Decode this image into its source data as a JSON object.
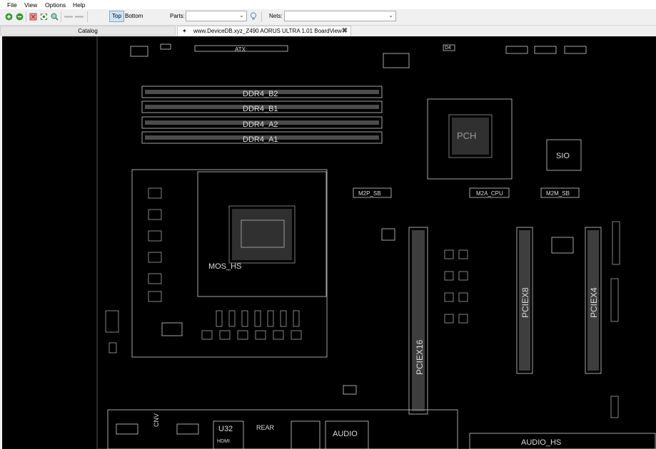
{
  "menu": {
    "items": [
      {
        "label": "File"
      },
      {
        "label": "View"
      },
      {
        "label": "Options"
      },
      {
        "label": "Help"
      }
    ]
  },
  "toolbar": {
    "icons": [
      "zoom-in-icon",
      "zoom-out-icon",
      "fit-icon",
      "fit-screen-icon",
      "zoom-area-icon",
      "back-icon",
      "forward-icon"
    ],
    "side_top": "Top",
    "side_bottom": "Bottom",
    "parts_label": "Parts:",
    "parts_value": "",
    "nets_label": "Nets:",
    "nets_value": ""
  },
  "tabs": {
    "catalog": "Catalog",
    "document_pin": "✶",
    "document": "www.DeviceDB.xyz_Z490 AORUS ULTRA 1.01 BoardView",
    "close": "✖"
  },
  "board": {
    "labels": {
      "atx": "ATX",
      "ddr4_b2": "DDR4_B2",
      "ddr4_b1": "DDR4_B1",
      "ddr4_a2": "DDR4_A2",
      "ddr4_a1": "DDR4_A1",
      "pch": "PCH",
      "sio": "SIO",
      "m2p_sb": "M2P_SB",
      "m2a_cpu": "M2A_CPU",
      "m2m_sb": "M2M_SB",
      "mos_hs": "MOS_HS",
      "pciex16": "PCIEX16",
      "pciex8": "PCIEX8",
      "pciex4": "PCIEX4",
      "audio": "AUDIO",
      "audio_hs": "AUDIO_HS",
      "hdmi": "HDMI",
      "u32": "U32",
      "d4": "D4",
      "cnv": "CNV",
      "rear": "REAR"
    }
  }
}
